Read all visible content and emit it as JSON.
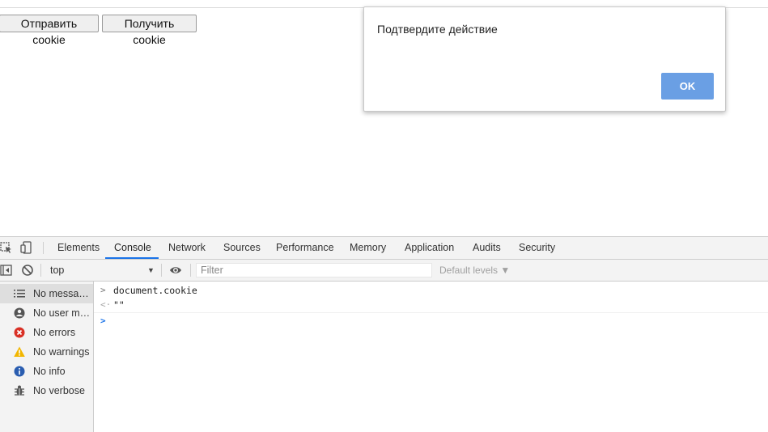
{
  "page": {
    "buttons": [
      {
        "label": "Отправить cookie"
      },
      {
        "label": "Получить cookie"
      }
    ]
  },
  "dialog": {
    "message": "Подтвердите действие",
    "ok_label": "OK"
  },
  "devtools": {
    "tabs": [
      "Elements",
      "Console",
      "Network",
      "Sources",
      "Performance",
      "Memory",
      "Application",
      "Audits",
      "Security"
    ],
    "active_tab": "Console",
    "toolbar": {
      "context": "top",
      "filter_placeholder": "Filter",
      "levels": "Default levels ▼"
    },
    "sidebar": [
      {
        "label": "No messages",
        "icon": "list-icon"
      },
      {
        "label": "No user me...",
        "icon": "user-icon"
      },
      {
        "label": "No errors",
        "icon": "error-icon"
      },
      {
        "label": "No warnings",
        "icon": "warning-icon"
      },
      {
        "label": "No info",
        "icon": "info-icon"
      },
      {
        "label": "No verbose",
        "icon": "bug-icon"
      }
    ],
    "console_lines": [
      {
        "prompt": ">",
        "text": "document.cookie"
      },
      {
        "prompt": "<·",
        "text": "\"\""
      },
      {
        "prompt": ">",
        "text": ""
      }
    ],
    "colors": {
      "accent": "#1a73e8",
      "error": "#d93025",
      "warning": "#f2b600",
      "info": "#2a5db0"
    }
  }
}
